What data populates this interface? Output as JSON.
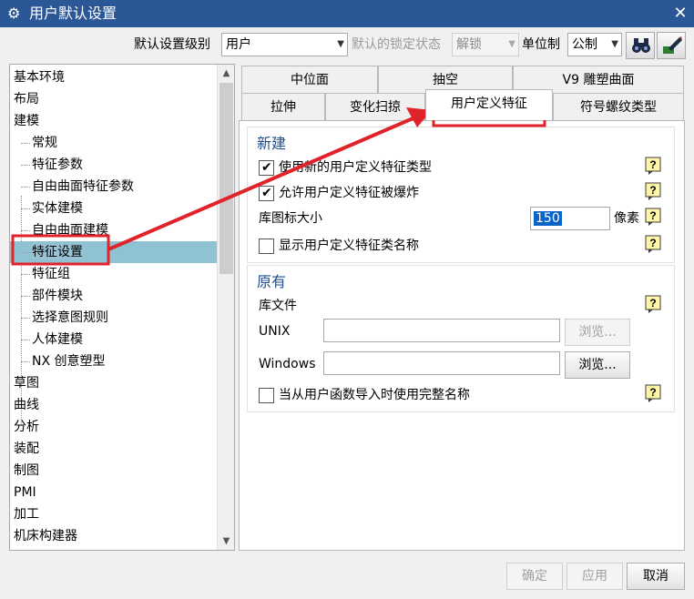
{
  "window": {
    "title": "用户默认设置",
    "close_symbol": "✕"
  },
  "toolbar": {
    "level_label": "默认设置级别",
    "level_value": "用户",
    "lock_label": "默认的锁定状态",
    "lock_value": "解锁",
    "unit_label": "单位制",
    "unit_value": "公制"
  },
  "icons": {
    "window": "gear-icon",
    "find": "binoculars-icon",
    "manage": "settings-manager-icon"
  },
  "tree": {
    "items": [
      {
        "label": "基本环境",
        "level": 0
      },
      {
        "label": "布局",
        "level": 0
      },
      {
        "label": "建模",
        "level": 0
      },
      {
        "label": "常规",
        "level": 1
      },
      {
        "label": "特征参数",
        "level": 1
      },
      {
        "label": "自由曲面特征参数",
        "level": 1
      },
      {
        "label": "实体建模",
        "level": 1
      },
      {
        "label": "自由曲面建模",
        "level": 1
      },
      {
        "label": "特征设置",
        "level": 1,
        "selected": true
      },
      {
        "label": "特征组",
        "level": 1
      },
      {
        "label": "部件模块",
        "level": 1
      },
      {
        "label": "选择意图规则",
        "level": 1
      },
      {
        "label": "人体建模",
        "level": 1
      },
      {
        "label": "NX 创意塑型",
        "level": 1
      },
      {
        "label": "草图",
        "level": 0
      },
      {
        "label": "曲线",
        "level": 0
      },
      {
        "label": "分析",
        "level": 0
      },
      {
        "label": "装配",
        "level": 0
      },
      {
        "label": "制图",
        "level": 0
      },
      {
        "label": "PMI",
        "level": 0
      },
      {
        "label": "加工",
        "level": 0
      },
      {
        "label": "机床构建器",
        "level": 0
      }
    ]
  },
  "tabs": {
    "row1": [
      "中位面",
      "抽空",
      "V9 雕塑曲面"
    ],
    "row2": [
      "拉伸",
      "变化扫掠",
      "用户定义特征",
      "符号螺纹类型"
    ],
    "active": "用户定义特征"
  },
  "new_group": {
    "title": "新建",
    "use_new_type": {
      "label": "使用新的用户定义特征类型",
      "checked": true
    },
    "allow_explode": {
      "label": "允许用户定义特征被爆炸",
      "checked": true
    },
    "icon_size_label": "库图标大小",
    "icon_size_value": "150",
    "icon_size_unit": "像素",
    "show_class_name": {
      "label": "显示用户定义特征类名称",
      "checked": false
    }
  },
  "legacy_group": {
    "title": "原有",
    "library_label": "库文件",
    "unix_label": "UNIX",
    "unix_value": "",
    "windows_label": "Windows",
    "windows_value": "",
    "browse_label": "浏览...",
    "full_name": {
      "label": "当从用户函数导入时使用完整名称",
      "checked": false
    }
  },
  "footer": {
    "ok": "确定",
    "apply": "应用",
    "cancel": "取消"
  },
  "colors": {
    "titlebar": "#2b5797",
    "selection": "#8fc3d3",
    "annotation": "#e0232b",
    "group_title": "#1f4e8c"
  }
}
